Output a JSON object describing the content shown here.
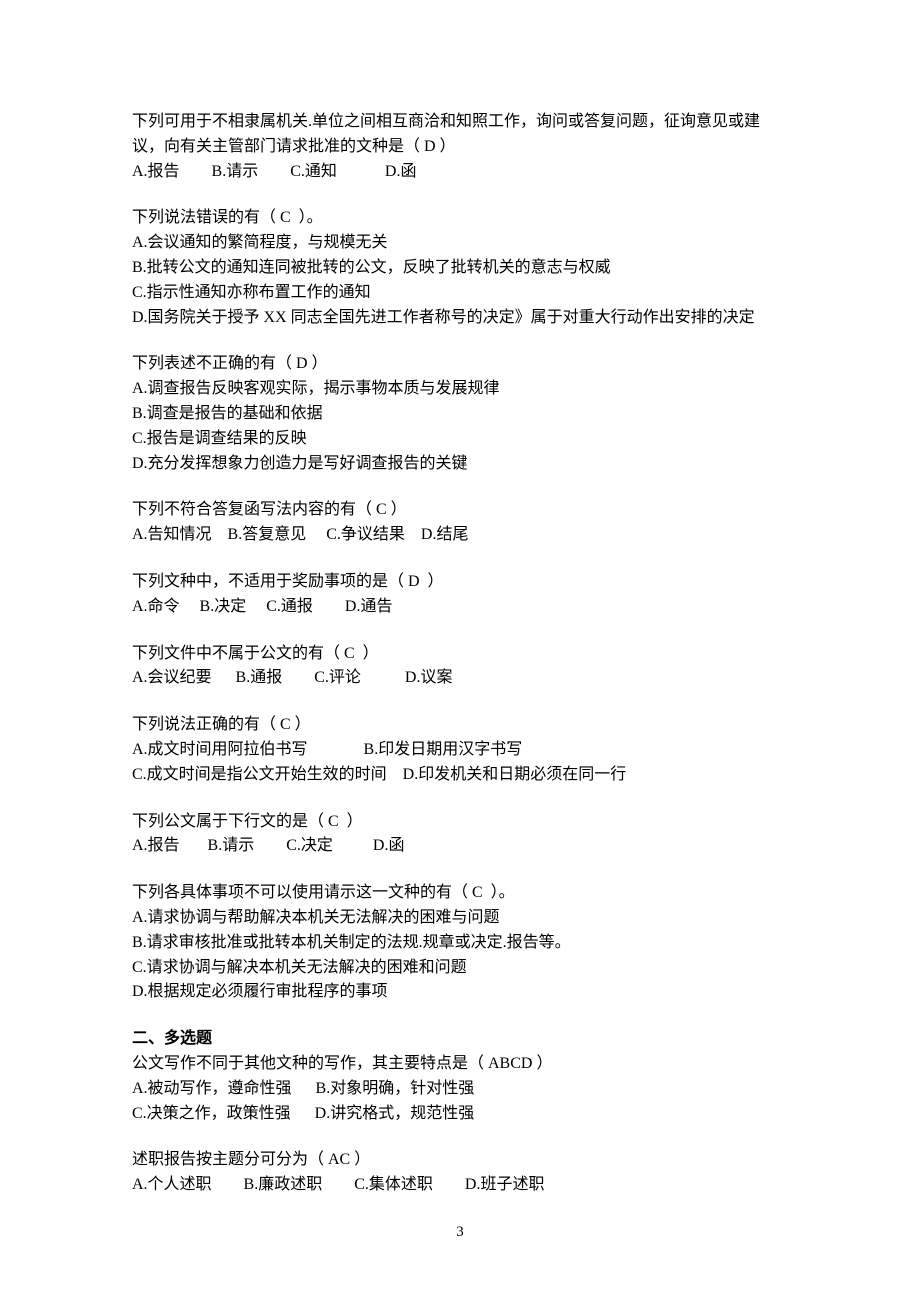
{
  "questions": [
    {
      "lines": [
        "下列可用于不相隶属机关.单位之间相互商洽和知照工作，询问或答复问题，征询意见或建议，向有关主管部门请求批准的文种是（ D ）",
        "A.报告        B.请示        C.通知            D.函"
      ]
    },
    {
      "lines": [
        "下列说法错误的有（ C  ）。",
        "A.会议通知的繁简程度，与规模无关",
        "B.批转公文的通知连同被批转的公文，反映了批转机关的意志与权威",
        "C.指示性通知亦称布置工作的通知",
        "D.国务院关于授予 XX 同志全国先进工作者称号的决定》属于对重大行动作出安排的决定"
      ]
    },
    {
      "lines": [
        "下列表述不正确的有（ D ）",
        "A.调查报告反映客观实际，揭示事物本质与发展规律",
        "B.调查是报告的基础和依据",
        "C.报告是调查结果的反映",
        "D.充分发挥想象力创造力是写好调查报告的关键"
      ]
    },
    {
      "lines": [
        "下列不符合答复函写法内容的有（ C ）",
        "A.告知情况    B.答复意见     C.争议结果    D.结尾"
      ]
    },
    {
      "lines": [
        "下列文种中，不适用于奖励事项的是（ D  ）",
        "A.命令     B.决定     C.通报        D.通告"
      ]
    },
    {
      "lines": [
        "下列文件中不属于公文的有（ C  ）",
        "A.会议纪要      B.通报        C.评论           D.议案"
      ]
    },
    {
      "lines": [
        "下列说法正确的有（ C ）",
        "A.成文时间用阿拉伯书写              B.印发日期用汉字书写",
        "C.成文时间是指公文开始生效的时间    D.印发机关和日期必须在同一行"
      ]
    },
    {
      "lines": [
        "下列公文属于下行文的是（ C  ）",
        "A.报告       B.请示        C.决定          D.函"
      ]
    },
    {
      "lines": [
        "下列各具体事项不可以使用请示这一文种的有（ C  ）。",
        "A.请求协调与帮助解决本机关无法解决的困难与问题",
        "B.请求审核批准或批转本机关制定的法规.规章或决定.报告等。",
        "C.请求协调与解决本机关无法解决的困难和问题",
        "D.根据规定必须履行审批程序的事项"
      ]
    }
  ],
  "sectionHeader": "二、多选题",
  "multi_questions": [
    {
      "lines": [
        "公文写作不同于其他文种的写作，其主要特点是（ ABCD ）",
        "A.被动写作，遵命性强      B.对象明确，针对性强",
        "C.决策之作，政策性强      D.讲究格式，规范性强"
      ]
    },
    {
      "lines": [
        "述职报告按主题分可分为（ AC ）",
        "A.个人述职        B.廉政述职        C.集体述职        D.班子述职"
      ]
    }
  ],
  "pageNumber": "3"
}
